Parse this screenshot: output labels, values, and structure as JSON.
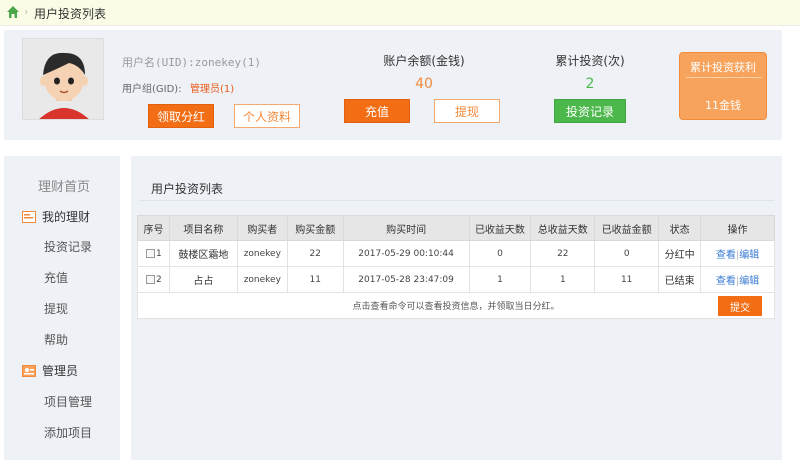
{
  "breadcrumb": {
    "title": "用户投资列表"
  },
  "user": {
    "name_text": "用户名(UID):zonekey(1)",
    "group_label": "用户组(GID):",
    "group_value": "管理员(1)",
    "dividend_button": "领取分红",
    "profile_button": "个人资料"
  },
  "balance": {
    "label": "账户余额(金钱)",
    "value": "40",
    "recharge_button": "充值",
    "withdraw_button": "提现"
  },
  "invest_count": {
    "label": "累计投资(次)",
    "value": "2",
    "records_button": "投资记录"
  },
  "profit_card": {
    "title": "累计投资获利",
    "value": "11金钱"
  },
  "sidebar": {
    "home": "理财首页",
    "section1": "我的理财",
    "section1_items": [
      "投资记录",
      "充值",
      "提现",
      "帮助"
    ],
    "section2": "管理员",
    "section2_items": [
      "项目管理",
      "添加项目"
    ]
  },
  "main": {
    "title": "用户投资列表",
    "columns": [
      "序号",
      "项目名称",
      "购买者",
      "购买金额",
      "购买时间",
      "已收益天数",
      "总收益天数",
      "已收益金额",
      "状态",
      "操作"
    ],
    "rows": [
      {
        "id": "1",
        "project": "鼓楼区霜地",
        "buyer": "zonekey",
        "amount": "22",
        "time": "2017-05-29 00:10:44",
        "earned_days": "0",
        "total_days": "22",
        "earned_amount": "0",
        "status": "分红中",
        "view": "查看",
        "edit": "编辑"
      },
      {
        "id": "2",
        "project": "占占",
        "buyer": "zonekey",
        "amount": "11",
        "time": "2017-05-28 23:47:09",
        "earned_days": "1",
        "total_days": "1",
        "earned_amount": "11",
        "status": "已结束",
        "view": "查看",
        "edit": "编辑"
      }
    ],
    "footer_text": "点击查看命令可以查看投资信息，并领取当日分红。",
    "submit_button": "提交"
  },
  "colors": {
    "accent_orange": "#f26d13",
    "green": "#4cb84c",
    "link_blue": "#3a7bd5",
    "panel_bg": "#eef2f7"
  }
}
